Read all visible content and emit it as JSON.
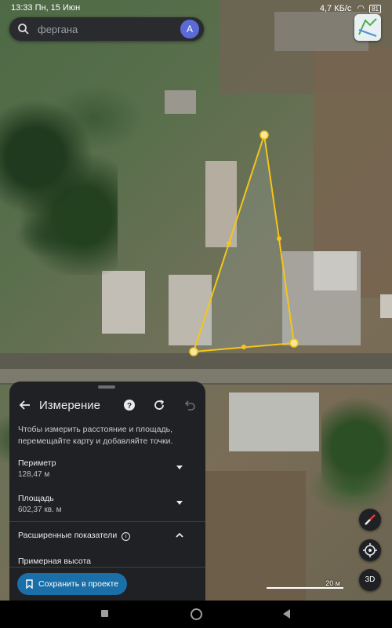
{
  "status_bar": {
    "time_date": "13:33 Пн, 15 Июн",
    "network": "4,7 КБ/с",
    "battery": "81"
  },
  "search": {
    "query": "фергана",
    "avatar_letter": "A"
  },
  "measure_panel": {
    "title": "Измерение",
    "description": "Чтобы измерить расстояние и площадь, перемещайте карту и добавляйте точки.",
    "perimeter_label": "Периметр",
    "perimeter_value": "128,47 м",
    "area_label": "Площадь",
    "area_value": "602,37 кв. м",
    "advanced_label": "Расширенные показатели",
    "approx_height_label": "Примерная высота",
    "save_button": "Сохранить в проекте"
  },
  "map_controls": {
    "view_3d": "3D",
    "scale_label": "20 м"
  },
  "colors": {
    "measure_line": "#f5c518",
    "panel_bg": "#202124",
    "save_button": "#1a6fa8"
  }
}
